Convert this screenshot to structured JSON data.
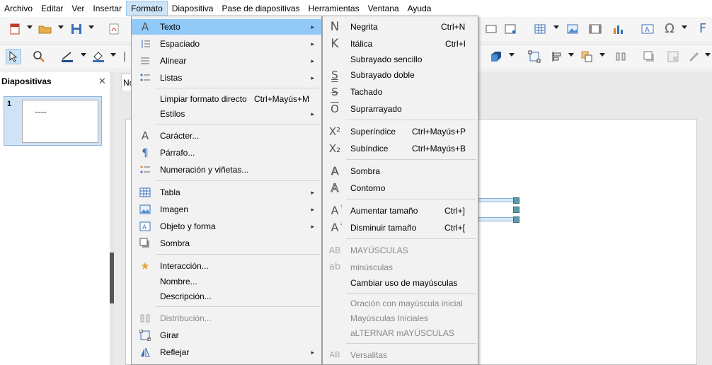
{
  "menubar": {
    "items": [
      "Archivo",
      "Editar",
      "Ver",
      "Insertar",
      "Formato",
      "Diapositiva",
      "Pase de diapositivas",
      "Herramientas",
      "Ventana",
      "Ayuda"
    ]
  },
  "slides_panel": {
    "title": "Diapositivas",
    "close_icon": "close-icon",
    "slide_number": "1",
    "thumb_text": "tenemos"
  },
  "workspace": {
    "tab_label": "No"
  },
  "format_menu": {
    "items": [
      {
        "label": "Texto",
        "icon": "text-icon",
        "submenu": true,
        "highlighted": true
      },
      {
        "label": "Espaciado",
        "submenu": true
      },
      {
        "label": "Alinear",
        "submenu": true
      },
      {
        "label": "Listas",
        "submenu": true
      },
      {
        "label": "Limpiar formato directo",
        "shortcut": "Ctrl+Mayús+M"
      },
      {
        "label": "Estilos",
        "submenu": true
      },
      {
        "label": "Carácter...",
        "icon": "character-icon"
      },
      {
        "label": "Párrafo...",
        "icon": "paragraph-icon"
      },
      {
        "label": "Numeración y viñetas...",
        "icon": "bullets-icon"
      },
      {
        "label": "Tabla",
        "icon": "table-icon",
        "submenu": true
      },
      {
        "label": "Imagen",
        "icon": "image-icon",
        "submenu": true
      },
      {
        "label": "Objeto y forma",
        "icon": "object-shape-icon",
        "submenu": true
      },
      {
        "label": "Sombra",
        "icon": "shadow-icon"
      },
      {
        "label": "Interacción...",
        "icon": "interaction-icon"
      },
      {
        "label": "Nombre..."
      },
      {
        "label": "Descripción..."
      },
      {
        "label": "Distribución...",
        "icon": "distribution-icon",
        "disabled": true
      },
      {
        "label": "Girar",
        "icon": "rotate-icon"
      },
      {
        "label": "Reflejar",
        "icon": "flip-icon",
        "submenu": true
      }
    ]
  },
  "text_menu": {
    "items": [
      {
        "label": "Negrita",
        "shortcut": "Ctrl+N",
        "icon": "bold-icon",
        "glyph": "N"
      },
      {
        "label": "Itálica",
        "shortcut": "Ctrl+I",
        "icon": "italic-icon",
        "glyph": "K"
      },
      {
        "label": "Subrayado sencillo",
        "icon": "underline-icon"
      },
      {
        "label": "Subrayado doble",
        "icon": "double-underline-icon",
        "glyph": "S"
      },
      {
        "label": "Tachado",
        "icon": "strikethrough-icon",
        "glyph": "S"
      },
      {
        "label": "Suprarrayado",
        "icon": "overline-icon",
        "glyph": "O"
      },
      {
        "label": "Superíndice",
        "shortcut": "Ctrl+Mayús+P",
        "icon": "superscript-icon",
        "glyph": "X²"
      },
      {
        "label": "Subíndice",
        "shortcut": "Ctrl+Mayús+B",
        "icon": "subscript-icon",
        "glyph": "X₂"
      },
      {
        "label": "Sombra",
        "icon": "text-shadow-icon",
        "glyph": "A"
      },
      {
        "label": "Contorno",
        "icon": "outline-icon",
        "glyph": "A"
      },
      {
        "label": "Aumentar tamaño",
        "shortcut": "Ctrl+]",
        "icon": "grow-font-icon",
        "glyph": "A"
      },
      {
        "label": "Disminuir tamaño",
        "shortcut": "Ctrl+[",
        "icon": "shrink-font-icon",
        "glyph": "A"
      },
      {
        "label": "MAYÚSCULAS",
        "icon": "uppercase-icon",
        "glyph": "AB",
        "disabled": true
      },
      {
        "label": "minúsculas",
        "icon": "lowercase-icon",
        "glyph": "ab",
        "disabled": true
      },
      {
        "label": "Cambiar uso de mayúsculas"
      },
      {
        "label": "Oración con mayúscula inicial",
        "disabled": true
      },
      {
        "label": "Mayúsculas Iniciales",
        "disabled": true
      },
      {
        "label": "aLTERNAR mAYÚSCULAS",
        "disabled": true
      },
      {
        "label": "Versalitas",
        "icon": "small-caps-icon",
        "glyph": "AB",
        "disabled": true
      }
    ]
  },
  "colors": {
    "highlight": "#91c9f7",
    "menu_bg": "#f2f2f2",
    "selection_bg": "#cfe2f6",
    "handle": "#5c9baa"
  }
}
